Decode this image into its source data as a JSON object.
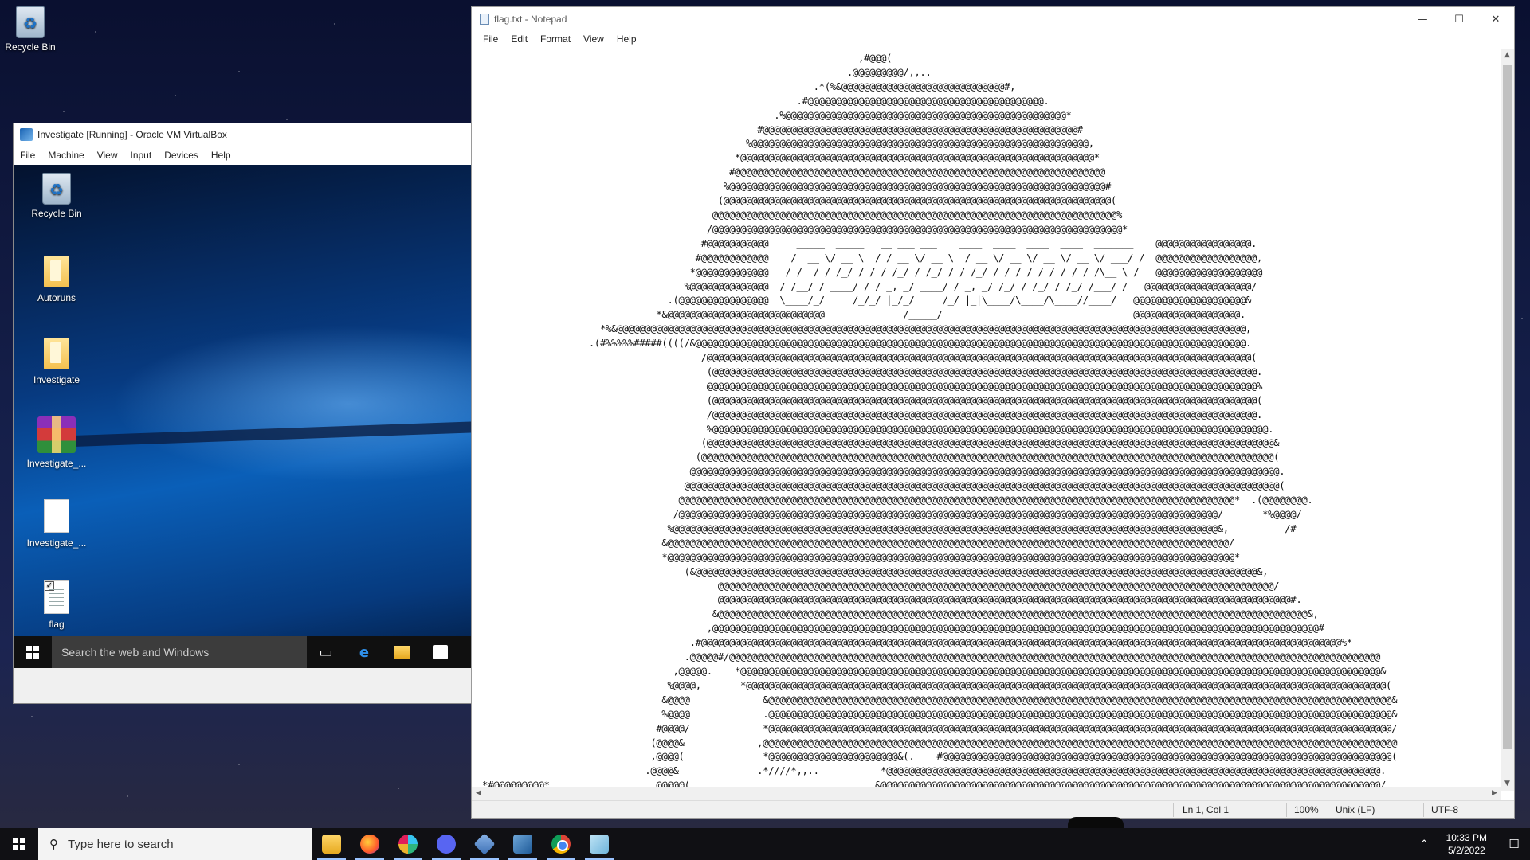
{
  "host_desktop": {
    "icons": [
      {
        "label": "Recycle Bin"
      }
    ]
  },
  "virtualbox": {
    "title": "Investigate [Running] - Oracle VM VirtualBox",
    "menu": [
      "File",
      "Machine",
      "View",
      "Input",
      "Devices",
      "Help"
    ],
    "guest": {
      "icons": [
        {
          "label": "Recycle Bin",
          "icon": "recycle-bin-icon"
        },
        {
          "label": "Autoruns",
          "icon": "folder-icon"
        },
        {
          "label": "Investigate",
          "icon": "folder-icon"
        },
        {
          "label": "Investigate_...",
          "icon": "winrar-archive-icon"
        },
        {
          "label": "Investigate_...",
          "icon": "blank-file-icon"
        },
        {
          "label": "flag",
          "icon": "text-file-icon"
        }
      ],
      "taskbar": {
        "search_placeholder": "Search the web and Windows"
      }
    }
  },
  "notepad": {
    "title": "flag.txt - Notepad",
    "menu": [
      "File",
      "Edit",
      "Format",
      "View",
      "Help"
    ],
    "content_lines": [
      "                                                                    ,#@@@(",
      "                                                                  .@@@@@@@@@/,,..",
      "                                                            .*(%&@@@@@@@@@@@@@@@@@@@@@@@@@@@@@#,",
      "                                                         .#@@@@@@@@@@@@@@@@@@@@@@@@@@@@@@@@@@@@@@@@@@.",
      "                                                     .%@@@@@@@@@@@@@@@@@@@@@@@@@@@@@@@@@@@@@@@@@@@@@@@@@@*",
      "                                                  #@@@@@@@@@@@@@@@@@@@@@@@@@@@@@@@@@@@@@@@@@@@@@@@@@@@@@@@@#",
      "                                                %@@@@@@@@@@@@@@@@@@@@@@@@@@@@@@@@@@@@@@@@@@@@@@@@@@@@@@@@@@@@,",
      "                                              *@@@@@@@@@@@@@@@@@@@@@@@@@@@@@@@@@@@@@@@@@@@@@@@@@@@@@@@@@@@@@@@*",
      "                                             #@@@@@@@@@@@@@@@@@@@@@@@@@@@@@@@@@@@@@@@@@@@@@@@@@@@@@@@@@@@@@@@@@@",
      "                                            %@@@@@@@@@@@@@@@@@@@@@@@@@@@@@@@@@@@@@@@@@@@@@@@@@@@@@@@@@@@@@@@@@@@#",
      "                                           (@@@@@@@@@@@@@@@@@@@@@@@@@@@@@@@@@@@@@@@@@@@@@@@@@@@@@@@@@@@@@@@@@@@@@(",
      "                                          @@@@@@@@@@@@@@@@@@@@@@@@@@@@@@@@@@@@@@@@@@@@@@@@@@@@@@@@@@@@@@@@@@@@@@@@%",
      "                                         /@@@@@@@@@@@@@@@@@@@@@@@@@@@@@@@@@@@@@@@@@@@@@@@@@@@@@@@@@@@@@@@@@@@@@@@@@*",
      "                                        #@@@@@@@@@@@     _____  _____   __ ___ ___    ____  ____  ____  ____  _______    @@@@@@@@@@@@@@@@@.",
      "                                       #@@@@@@@@@@@@    /  __ \\/ __ \\  / / __ \\/ __ \\  / __ \\/ __ \\/ __ \\/ __ \\/ ___/ /  @@@@@@@@@@@@@@@@@@,",
      "                                      *@@@@@@@@@@@@@   / /  / / /_/ / / / /_/ / /_/ / / /_/ / / / / / / / / / /\\__ \\ /   @@@@@@@@@@@@@@@@@@@",
      "                                     %@@@@@@@@@@@@@@  / /__/ / ____/ / / _, _/ ____/ / _, _/ /_/ / /_/ / /_/ /___/ /   @@@@@@@@@@@@@@@@@@@/",
      "                                  .(@@@@@@@@@@@@@@@@  \\____/_/     /_/_/ |_/_/     /_/ |_|\\____/\\____/\\____//____/   @@@@@@@@@@@@@@@@@@@@&",
      "                                *&@@@@@@@@@@@@@@@@@@@@@@@@@@@@              /_____/                                  @@@@@@@@@@@@@@@@@@@.",
      "                      *%&@@@@@@@@@@@@@@@@@@@@@@@@@@@@@@@@@@@@@@@@@@@@@@@@@@@@@@@@@@@@@@@@@@@@@@@@@@@@@@@@@@@@@@@@@@@@@@@@@@@@@@@@@@@@@@@@,",
      "                    .(#%%%%%#####((((/&@@@@@@@@@@@@@@@@@@@@@@@@@@@@@@@@@@@@@@@@@@@@@@@@@@@@@@@@@@@@@@@@@@@@@@@@@@@@@@@@@@@@@@@@@@@@@@@@@@.",
      "                                        /@@@@@@@@@@@@@@@@@@@@@@@@@@@@@@@@@@@@@@@@@@@@@@@@@@@@@@@@@@@@@@@@@@@@@@@@@@@@@@@@@@@@@@@@@@@@@@@@@(",
      "                                         (@@@@@@@@@@@@@@@@@@@@@@@@@@@@@@@@@@@@@@@@@@@@@@@@@@@@@@@@@@@@@@@@@@@@@@@@@@@@@@@@@@@@@@@@@@@@@@@@@.",
      "                                         @@@@@@@@@@@@@@@@@@@@@@@@@@@@@@@@@@@@@@@@@@@@@@@@@@@@@@@@@@@@@@@@@@@@@@@@@@@@@@@@@@@@@@@@@@@@@@@@@@%",
      "                                         (@@@@@@@@@@@@@@@@@@@@@@@@@@@@@@@@@@@@@@@@@@@@@@@@@@@@@@@@@@@@@@@@@@@@@@@@@@@@@@@@@@@@@@@@@@@@@@@@@(",
      "                                         /@@@@@@@@@@@@@@@@@@@@@@@@@@@@@@@@@@@@@@@@@@@@@@@@@@@@@@@@@@@@@@@@@@@@@@@@@@@@@@@@@@@@@@@@@@@@@@@@@.",
      "                                         %@@@@@@@@@@@@@@@@@@@@@@@@@@@@@@@@@@@@@@@@@@@@@@@@@@@@@@@@@@@@@@@@@@@@@@@@@@@@@@@@@@@@@@@@@@@@@@@@@@@.",
      "                                        (@@@@@@@@@@@@@@@@@@@@@@@@@@@@@@@@@@@@@@@@@@@@@@@@@@@@@@@@@@@@@@@@@@@@@@@@@@@@@@@@@@@@@@@@@@@@@@@@@@@@@&",
      "                                       (@@@@@@@@@@@@@@@@@@@@@@@@@@@@@@@@@@@@@@@@@@@@@@@@@@@@@@@@@@@@@@@@@@@@@@@@@@@@@@@@@@@@@@@@@@@@@@@@@@@@@@(",
      "                                      @@@@@@@@@@@@@@@@@@@@@@@@@@@@@@@@@@@@@@@@@@@@@@@@@@@@@@@@@@@@@@@@@@@@@@@@@@@@@@@@@@@@@@@@@@@@@@@@@@@@@@@@@.",
      "                                     @@@@@@@@@@@@@@@@@@@@@@@@@@@@@@@@@@@@@@@@@@@@@@@@@@@@@@@@@@@@@@@@@@@@@@@@@@@@@@@@@@@@@@@@@@@@@@@@@@@@@@@@@@(",
      "                                    @@@@@@@@@@@@@@@@@@@@@@@@@@@@@@@@@@@@@@@@@@@@@@@@@@@@@@@@@@@@@@@@@@@@@@@@@@@@@@@@@@@@@@@@@@@@@@@@@@@*  .(@@@@@@@@.",
      "                                   /@@@@@@@@@@@@@@@@@@@@@@@@@@@@@@@@@@@@@@@@@@@@@@@@@@@@@@@@@@@@@@@@@@@@@@@@@@@@@@@@@@@@@@@@@@@@@@@@/       *%@@@@/",
      "                                  %@@@@@@@@@@@@@@@@@@@@@@@@@@@@@@@@@@@@@@@@@@@@@@@@@@@@@@@@@@@@@@@@@@@@@@@@@@@@@@@@@@@@@@@@@@@@@@@@@&,          /#",
      "                                 &@@@@@@@@@@@@@@@@@@@@@@@@@@@@@@@@@@@@@@@@@@@@@@@@@@@@@@@@@@@@@@@@@@@@@@@@@@@@@@@@@@@@@@@@@@@@@@@@@@@@/",
      "                                 *@@@@@@@@@@@@@@@@@@@@@@@@@@@@@@@@@@@@@@@@@@@@@@@@@@@@@@@@@@@@@@@@@@@@@@@@@@@@@@@@@@@@@@@@@@@@@@@@@@@@@*",
      "                                     (&@@@@@@@@@@@@@@@@@@@@@@@@@@@@@@@@@@@@@@@@@@@@@@@@@@@@@@@@@@@@@@@@@@@@@@@@@@@@@@@@@@@@@@@@@@@@@@@@@@@@&,",
      "                                           @@@@@@@@@@@@@@@@@@@@@@@@@@@@@@@@@@@@@@@@@@@@@@@@@@@@@@@@@@@@@@@@@@@@@@@@@@@@@@@@@@@@@@@@@@@@@@@@@@@/",
      "                                           @@@@@@@@@@@@@@@@@@@@@@@@@@@@@@@@@@@@@@@@@@@@@@@@@@@@@@@@@@@@@@@@@@@@@@@@@@@@@@@@@@@@@@@@@@@@@@@@@@@@@@#.",
      "                                          &@@@@@@@@@@@@@@@@@@@@@@@@@@@@@@@@@@@@@@@@@@@@@@@@@@@@@@@@@@@@@@@@@@@@@@@@@@@@@@@@@@@@@@@@@@@@@@@@@@@@@@@@@&,",
      "                                         ,@@@@@@@@@@@@@@@@@@@@@@@@@@@@@@@@@@@@@@@@@@@@@@@@@@@@@@@@@@@@@@@@@@@@@@@@@@@@@@@@@@@@@@@@@@@@@@@@@@@@@@@@@@@@#",
      "                                      .#@@@@@@@@@@@@@@@@@@@@@@@@@@@@@@@@@@@@@@@@@@@@@@@@@@@@@@@@@@@@@@@@@@@@@@@@@@@@@@@@@@@@@@@@@@@@@@@@@@@@@@@@@@@@@@@@@@%*",
      "                                     .@@@@@#/@@@@@@@@@@@@@@@@@@@@@@@@@@@@@@@@@@@@@@@@@@@@@@@@@@@@@@@@@@@@@@@@@@@@@@@@@@@@@@@@@@@@@@@@@@@@@@@@@@@@@@@@@@@@@@@@@@@@",
      "                                   ,@@@@@.    *@@@@@@@@@@@@@@@@@@@@@@@@@@@@@@@@@@@@@@@@@@@@@@@@@@@@@@@@@@@@@@@@@@@@@@@@@@@@@@@@@@@@@@@@@@@@@@@@@@@@@@@@@@@@@@@@@@&",
      "                                  %@@@@,       *@@@@@@@@@@@@@@@@@@@@@@@@@@@@@@@@@@@@@@@@@@@@@@@@@@@@@@@@@@@@@@@@@@@@@@@@@@@@@@@@@@@@@@@@@@@@@@@@@@@@@@@@@@@@@@@@@@(",
      "                                 &@@@@             &@@@@@@@@@@@@@@@@@@@@@@@@@@@@@@@@@@@@@@@@@@@@@@@@@@@@@@@@@@@@@@@@@@@@@@@@@@@@@@@@@@@@@@@@@@@@@@@@@@@@@@@@@@@@@@@&",
      "                                 %@@@@             .@@@@@@@@@@@@@@@@@@@@@@@@@@@@@@@@@@@@@@@@@@@@@@@@@@@@@@@@@@@@@@@@@@@@@@@@@@@@@@@@@@@@@@@@@@@@@@@@@@@@@@@@@@@@@@@&",
      "                                #@@@@/             *@@@@@@@@@@@@@@@@@@@@@@@@@@@@@@@@@@@@@@@@@@@@@@@@@@@@@@@@@@@@@@@@@@@@@@@@@@@@@@@@@@@@@@@@@@@@@@@@@@@@@@@@@@@@@@@/",
      "                               (@@@@&             ,@@@@@@@@@@@@@@@@@@@@@@@@@@@@@@@@@@@@@@@@@@@@@@@@@@@@@@@@@@@@@@@@@@@@@@@@@@@@@@@@@@@@@@@@@@@@@@@@@@@@@@@@@@@@@@@@@",
      "                               ,@@@@(              *@@@@@@@@@@@@@@@@@@@@@@@&(.    #@@@@@@@@@@@@@@@@@@@@@@@@@@@@@@@@@@@@@@@@@@@@@@@@@@@@@@@@@@@@@@@@@@@@@@@@@@@@@@@@(",
      "                              .@@@@&              .*////*,,..           *@@@@@@@@@@@@@@@@@@@@@@@@@@@@@@@@@@@@@@@@@@@@@@@@@@@@@@@@@@@@@@@@@@@@@@@@@@@@@@@@@@@@@@@@.",
      " *#@@@@@@@@@*                   @@@@@(                                 &@@@@@@@@@@@@@@@@@@@@@@@@@@@@@@@@@@@@@@@@@@@@@@@@@@@@@@@@@@@@@@@@@@@@@@@@@@@@@@@@@@@@@@@@@/"
    ],
    "status": {
      "position": "Ln 1, Col 1",
      "zoom": "100%",
      "line_ending": "Unix (LF)",
      "encoding": "UTF-8"
    }
  },
  "taskbar": {
    "search_placeholder": "Type here to search",
    "apps": [
      {
        "name": "file-explorer-icon",
        "active": true
      },
      {
        "name": "firefox-icon",
        "active": true
      },
      {
        "name": "slack-icon",
        "active": true
      },
      {
        "name": "discord-icon",
        "active": true
      },
      {
        "name": "virtualbox-icon",
        "active": true
      },
      {
        "name": "wireshark-icon",
        "active": true
      },
      {
        "name": "chrome-icon",
        "active": true
      },
      {
        "name": "notepad-icon",
        "active": true
      }
    ],
    "clock": {
      "time": "10:33 PM",
      "date": "5/2/2022"
    }
  }
}
